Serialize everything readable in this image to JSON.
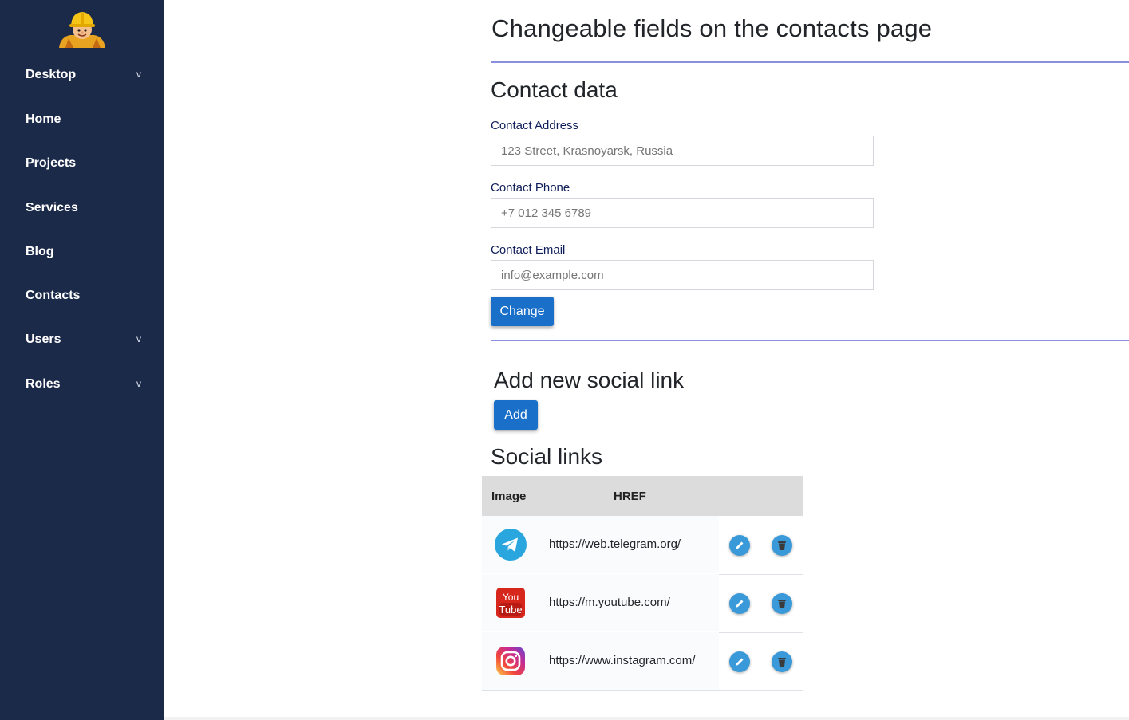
{
  "sidebar": {
    "items": [
      {
        "label": "Desktop",
        "has_submenu": true
      },
      {
        "label": "Home",
        "has_submenu": false
      },
      {
        "label": "Projects",
        "has_submenu": false
      },
      {
        "label": "Services",
        "has_submenu": false
      },
      {
        "label": "Blog",
        "has_submenu": false
      },
      {
        "label": "Contacts",
        "has_submenu": false
      },
      {
        "label": "Users",
        "has_submenu": true
      },
      {
        "label": "Roles",
        "has_submenu": true
      }
    ],
    "chevron": "v",
    "background": "#1c2a4a"
  },
  "main": {
    "page_title": "Changeable fields on the contacts page",
    "contact_section": {
      "title": "Contact data",
      "address": {
        "label": "Contact Address",
        "placeholder": "123 Street, Krasnoyarsk, Russia",
        "value": ""
      },
      "phone": {
        "label": "Contact Phone",
        "placeholder": "+7 012 345 6789",
        "value": ""
      },
      "email": {
        "label": "Contact Email",
        "placeholder": "info@example.com",
        "value": ""
      },
      "change_button": "Change"
    },
    "add_section": {
      "title": "Add new social link",
      "add_button": "Add"
    },
    "social_section": {
      "title": "Social links",
      "columns": [
        "Image",
        "HREF"
      ],
      "rows": [
        {
          "icon": "telegram-icon",
          "href": "https://web.telegram.org/"
        },
        {
          "icon": "youtube-icon",
          "href": "https://m.youtube.com/"
        },
        {
          "icon": "instagram-icon",
          "href": "https://www.instagram.com/"
        }
      ]
    }
  },
  "colors": {
    "accent": "#1a6fc9",
    "divider": "#8a8fdf",
    "label": "#0f1e5a",
    "action_circle": "#3a9ad9"
  }
}
